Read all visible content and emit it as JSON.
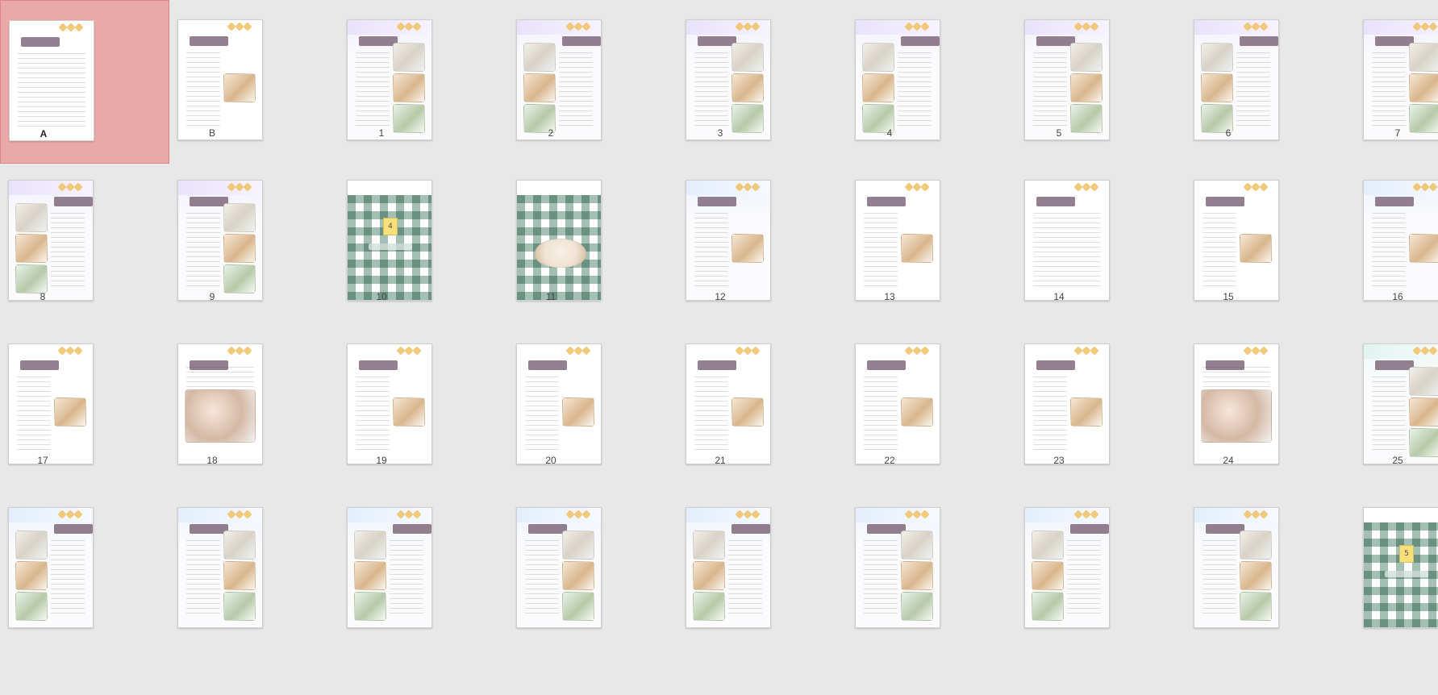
{
  "thumbnails": [
    {
      "label": "A",
      "selected": true,
      "tint": "white",
      "variant": "text"
    },
    {
      "label": "B",
      "selected": false,
      "tint": "white",
      "variant": "text_photo"
    },
    {
      "label": "1",
      "selected": false,
      "tint": "lav",
      "variant": "recipe"
    },
    {
      "label": "2",
      "selected": false,
      "tint": "lav",
      "variant": "recipe_left"
    },
    {
      "label": "3",
      "selected": false,
      "tint": "lav",
      "variant": "recipe"
    },
    {
      "label": "4",
      "selected": false,
      "tint": "lav",
      "variant": "recipe_left"
    },
    {
      "label": "5",
      "selected": false,
      "tint": "lav",
      "variant": "recipe"
    },
    {
      "label": "6",
      "selected": false,
      "tint": "lav",
      "variant": "recipe_left"
    },
    {
      "label": "7",
      "selected": false,
      "tint": "lav",
      "variant": "recipe"
    },
    {
      "label": "8",
      "selected": false,
      "tint": "lav",
      "variant": "recipe_left"
    },
    {
      "label": "9",
      "selected": false,
      "tint": "lav",
      "variant": "recipe"
    },
    {
      "label": "10",
      "selected": false,
      "tint": "white",
      "variant": "part",
      "part_text": "4"
    },
    {
      "label": "11",
      "selected": false,
      "tint": "white",
      "variant": "part_bowl"
    },
    {
      "label": "12",
      "selected": false,
      "tint": "blue",
      "variant": "text_photo"
    },
    {
      "label": "13",
      "selected": false,
      "tint": "white",
      "variant": "text_photo"
    },
    {
      "label": "14",
      "selected": false,
      "tint": "white",
      "variant": "text"
    },
    {
      "label": "15",
      "selected": false,
      "tint": "white",
      "variant": "text_photo"
    },
    {
      "label": "16",
      "selected": false,
      "tint": "blue",
      "variant": "text_photo"
    },
    {
      "label": "17",
      "selected": false,
      "tint": "white",
      "variant": "text_photo"
    },
    {
      "label": "18",
      "selected": false,
      "tint": "white",
      "variant": "photo"
    },
    {
      "label": "19",
      "selected": false,
      "tint": "white",
      "variant": "text_photo"
    },
    {
      "label": "20",
      "selected": false,
      "tint": "white",
      "variant": "text_photo"
    },
    {
      "label": "21",
      "selected": false,
      "tint": "white",
      "variant": "text_photo"
    },
    {
      "label": "22",
      "selected": false,
      "tint": "white",
      "variant": "text_photo"
    },
    {
      "label": "23",
      "selected": false,
      "tint": "white",
      "variant": "text_photo"
    },
    {
      "label": "24",
      "selected": false,
      "tint": "white",
      "variant": "photo"
    },
    {
      "label": "25",
      "selected": false,
      "tint": "mint",
      "variant": "recipe"
    },
    {
      "label": "",
      "selected": false,
      "tint": "blue",
      "variant": "recipe_left"
    },
    {
      "label": "",
      "selected": false,
      "tint": "blue",
      "variant": "recipe"
    },
    {
      "label": "",
      "selected": false,
      "tint": "blue",
      "variant": "recipe_left"
    },
    {
      "label": "",
      "selected": false,
      "tint": "blue",
      "variant": "recipe"
    },
    {
      "label": "",
      "selected": false,
      "tint": "blue",
      "variant": "recipe_left"
    },
    {
      "label": "",
      "selected": false,
      "tint": "blue",
      "variant": "recipe"
    },
    {
      "label": "",
      "selected": false,
      "tint": "blue",
      "variant": "recipe_left"
    },
    {
      "label": "",
      "selected": false,
      "tint": "blue",
      "variant": "recipe"
    },
    {
      "label": "",
      "selected": false,
      "tint": "white",
      "variant": "part",
      "part_text": "5"
    }
  ]
}
